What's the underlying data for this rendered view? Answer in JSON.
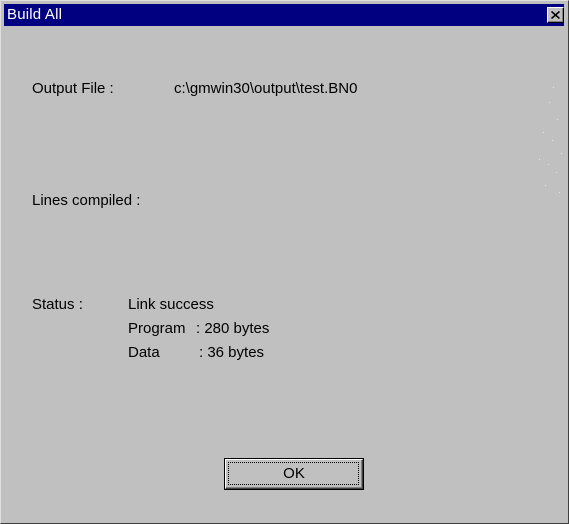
{
  "window": {
    "title": "Build All",
    "close_glyph": "close-icon"
  },
  "output": {
    "label": "Output File :",
    "value": "c:\\gmwin30\\output\\test.BN0"
  },
  "lines": {
    "label": "Lines compiled :",
    "value": ""
  },
  "status": {
    "label": "Status :",
    "result": "Link success",
    "program_label": "Program",
    "program_value": ": 280 bytes",
    "data_label": "Data",
    "data_value": ": 36 bytes"
  },
  "buttons": {
    "ok_label": "OK"
  },
  "colors": {
    "titlebar": "#000080",
    "face": "#c0c0c0"
  }
}
